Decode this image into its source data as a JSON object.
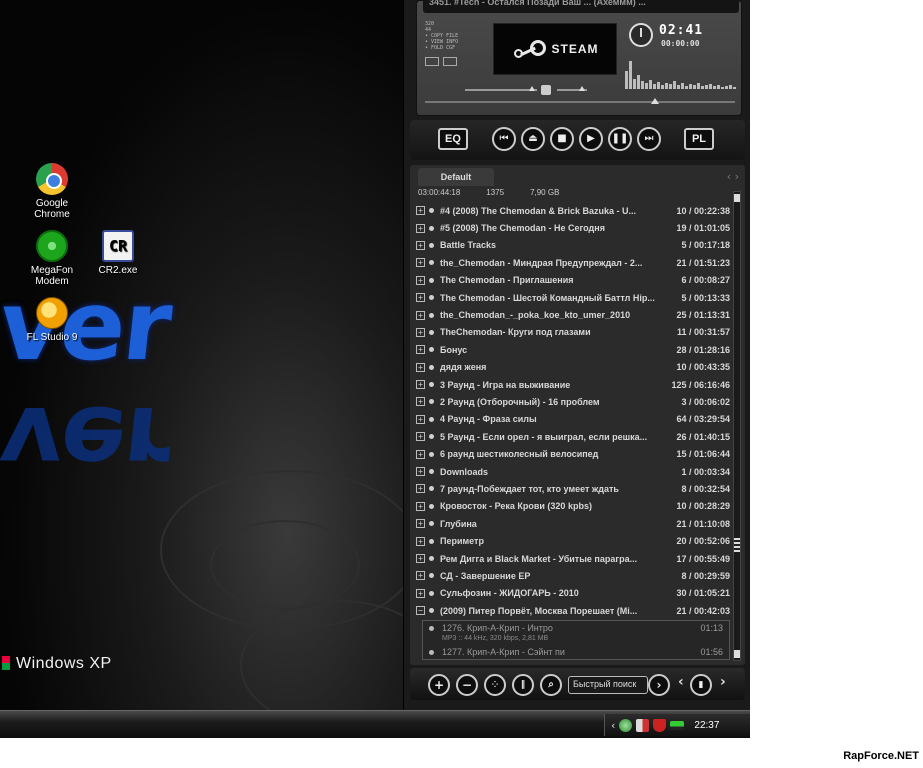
{
  "desktop": {
    "logo_text": "ver",
    "os_label": "Windows XP",
    "icons": [
      {
        "label": "Google Chrome",
        "icon": "chrome-icon"
      },
      {
        "label": "MegaFon Modem",
        "icon": "megafon-icon"
      },
      {
        "label": "CR2.exe",
        "icon": "cr2-icon",
        "glyph": "CR"
      },
      {
        "label": "FL Studio 9",
        "icon": "fl-studio-icon"
      }
    ]
  },
  "taskbar": {
    "clock": "22:37",
    "tray_icons": [
      "arrow-left-icon",
      "network-icon",
      "flag-icon",
      "shield-icon",
      "battery-icon"
    ]
  },
  "player": {
    "now_playing": "3451. #Tech - Остался Позади Ваш ... (Ахеммм) ...",
    "steam_label": "STEAM",
    "time_elapsed": "02:41",
    "time_remaining": "00:00:00",
    "left_info": [
      "320",
      "44",
      "• COPY FILE",
      "• VIEW INFO",
      "• FOLD CGF"
    ],
    "buttons": {
      "eq": "EQ",
      "pl": "PL"
    },
    "transport": [
      "prev-icon",
      "eject-icon",
      "stop-icon",
      "play-icon",
      "pause-icon",
      "next-icon"
    ]
  },
  "playlist": {
    "tab": "Default",
    "total_time": "03:00:44:18",
    "track_count": "1375",
    "size": "7,90 GB",
    "groups": [
      {
        "name": "#4 (2008) The Chemodan & Brick Bazuka - U...",
        "info": "10 / 00:22:38"
      },
      {
        "name": "#5 (2008) The Chemodan - Не Сегодня",
        "info": "19 / 01:01:05"
      },
      {
        "name": "Battle Tracks",
        "info": "5 / 00:17:18"
      },
      {
        "name": "the_Chemodan - Миндрая Предупреждал - 2...",
        "info": "21 / 01:51:23"
      },
      {
        "name": "The Chemodan - Приглашения",
        "info": "6 / 00:08:27"
      },
      {
        "name": "The Chemodan - Шестой Командный Баттл Hip...",
        "info": "5 / 00:13:33"
      },
      {
        "name": "the_Chemodan_-_poka_koe_kto_umer_2010",
        "info": "25 / 01:13:31"
      },
      {
        "name": "TheChemodan- Круги под глазами",
        "info": "11 / 00:31:57"
      },
      {
        "name": "Бонус",
        "info": "28 / 01:28:16"
      },
      {
        "name": "дядя женя",
        "info": "10 / 00:43:35"
      },
      {
        "name": "3 Раунд - Игра на выживание",
        "info": "125 / 06:16:46"
      },
      {
        "name": "2 Раунд (Отборочный) - 16 проблем",
        "info": "3 / 00:06:02"
      },
      {
        "name": "4 Раунд - Фраза силы",
        "info": "64 / 03:29:54"
      },
      {
        "name": "5 Раунд - Если орел - я выиграл, если решка...",
        "info": "26 / 01:40:15"
      },
      {
        "name": "6 раунд шестиколесный велосипед",
        "info": "15 / 01:06:44"
      },
      {
        "name": "Downloads",
        "info": "1 / 00:03:34"
      },
      {
        "name": "7 раунд-Побеждает тот, кто умеет ждать",
        "info": "8 / 00:32:54"
      },
      {
        "name": "Кровосток - Река Крови (320 kpbs)",
        "info": "10 / 00:28:29"
      },
      {
        "name": "Глубина",
        "info": "21 / 01:10:08"
      },
      {
        "name": "Периметр",
        "info": "20 / 00:52:06"
      },
      {
        "name": "Рем Дигга и Black Market - Убитые парагра...",
        "info": "17 / 00:55:49"
      },
      {
        "name": "СД - Завершение EP",
        "info": "8 / 00:29:59"
      },
      {
        "name": "Сульфозин - ЖИДОГАРЬ - 2010",
        "info": "30 / 01:05:21"
      },
      {
        "name": "(2009) Питер Порвёт, Москва Порешает (Mi...",
        "info": "21 / 00:42:03"
      }
    ],
    "expanded_tracks": [
      {
        "name": "1276. Крип-А-Крип - Интро",
        "time": "01:13",
        "meta": "MP3 :: 44 kHz, 320 kbps, 2,81 MB"
      },
      {
        "name": "1277. Крип-А-Крип - Сэйнт пи",
        "time": "01:56",
        "meta": ""
      }
    ],
    "quick_search_placeholder": "Быстрый поиск"
  },
  "watermark": "RapForce.NET"
}
